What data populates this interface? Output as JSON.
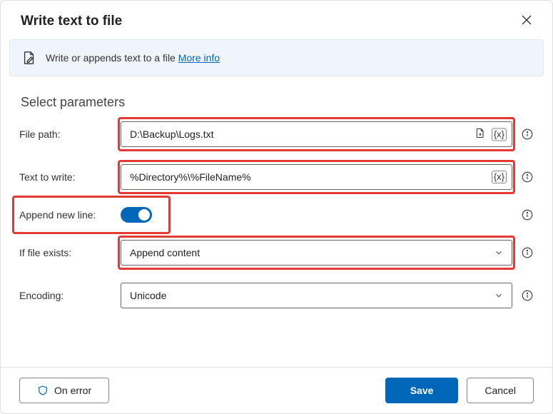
{
  "dialog": {
    "title": "Write text to file",
    "info_text": "Write or appends text to a file ",
    "more_info": "More info",
    "section_heading": "Select parameters"
  },
  "fields": {
    "file_path": {
      "label": "File path:",
      "value": "D:\\Backup\\Logs.txt"
    },
    "text_to_write": {
      "label": "Text to write:",
      "value": "%Directory%\\%FileName%"
    },
    "append_new_line": {
      "label": "Append new line:",
      "value": true
    },
    "if_file_exists": {
      "label": "If file exists:",
      "value": "Append content"
    },
    "encoding": {
      "label": "Encoding:",
      "value": "Unicode"
    }
  },
  "footer": {
    "on_error": "On error",
    "save": "Save",
    "cancel": "Cancel"
  }
}
